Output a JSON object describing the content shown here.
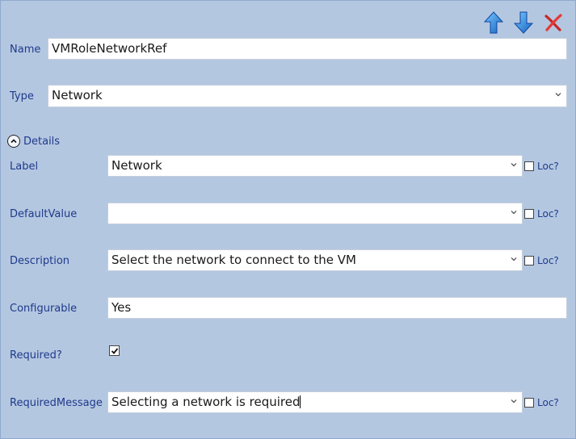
{
  "toolbar": {
    "icons": [
      "arrow-up-icon",
      "arrow-down-icon",
      "delete-x-icon"
    ],
    "colors": {
      "arrow": "#1e88e5",
      "delete": "#d32f2f"
    }
  },
  "name": {
    "label": "Name",
    "value": "VMRoleNetworkRef"
  },
  "type": {
    "label": "Type",
    "value": "Network"
  },
  "details": {
    "label": "Details"
  },
  "label_field": {
    "label": "Label",
    "value": "Network",
    "loc": "Loc?"
  },
  "default_value": {
    "label": "DefaultValue",
    "value": "",
    "loc": "Loc?"
  },
  "description": {
    "label": "Description",
    "value": "Select the network to connect to the VM",
    "loc": "Loc?"
  },
  "configurable": {
    "label": "Configurable",
    "value": "Yes"
  },
  "required": {
    "label": "Required?",
    "checked": true
  },
  "required_message": {
    "label": "RequiredMessage",
    "value": "Selecting a network is required",
    "loc": "Loc?"
  },
  "theme": {
    "background": "#b4c7e1",
    "label_color": "#1f3a8a"
  }
}
